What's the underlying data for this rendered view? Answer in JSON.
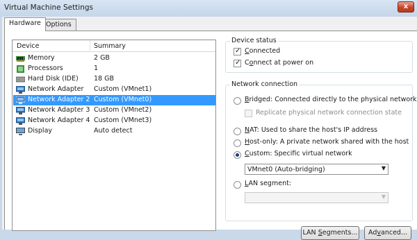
{
  "window": {
    "title": "Virtual Machine Settings",
    "close_label": "x"
  },
  "tabs": [
    {
      "label": "Hardware"
    },
    {
      "label": "Options"
    }
  ],
  "device_list": {
    "headers": {
      "device": "Device",
      "summary": "Summary"
    },
    "rows": [
      {
        "device": "Memory",
        "summary": "2 GB",
        "icon": "memory-icon"
      },
      {
        "device": "Processors",
        "summary": "1",
        "icon": "processor-icon"
      },
      {
        "device": "Hard Disk (IDE)",
        "summary": "18 GB",
        "icon": "hard-disk-icon"
      },
      {
        "device": "Network Adapter",
        "summary": "Custom (VMnet1)",
        "icon": "network-adapter-icon"
      },
      {
        "device": "Network Adapter 2",
        "summary": "Custom (VMnet0)",
        "icon": "network-adapter-icon",
        "selected": true
      },
      {
        "device": "Network Adapter 3",
        "summary": "Custom (VMnet2)",
        "icon": "network-adapter-icon"
      },
      {
        "device": "Network Adapter 4",
        "summary": "Custom (VMnet3)",
        "icon": "network-adapter-icon"
      },
      {
        "device": "Display",
        "summary": "Auto detect",
        "icon": "display-icon"
      }
    ]
  },
  "device_status": {
    "title": "Device status",
    "connected": {
      "pre": "",
      "key": "C",
      "post": "onnected",
      "checked": true
    },
    "connect_at_power_on": {
      "pre": "C",
      "key": "o",
      "post": "nnect at power on",
      "checked": true
    }
  },
  "network_connection": {
    "title": "Network connection",
    "bridged": {
      "key": "B",
      "post": "ridged: Connected directly to the physical network",
      "selected": false
    },
    "replicate": {
      "label": "Replicate physical network connection state",
      "checked": false,
      "disabled": true
    },
    "nat": {
      "key": "N",
      "post": "AT: Used to share the host's IP address",
      "selected": false
    },
    "host_only": {
      "key": "H",
      "post": "ost-only: A private network shared with the host",
      "selected": false
    },
    "custom": {
      "key": "C",
      "post": "ustom: Specific virtual network",
      "selected": true
    },
    "custom_select_value": "VMnet0 (Auto-bridging)",
    "lan_segment": {
      "key": "L",
      "post": "AN segment:",
      "selected": false
    },
    "lan_select_value": ""
  },
  "buttons": {
    "lan_segments": {
      "pre": "LAN ",
      "key": "S",
      "post": "egments..."
    },
    "advanced": {
      "pre": "Ad",
      "key": "v",
      "post": "anced..."
    }
  },
  "colors": {
    "selection": "#3399ff",
    "title_bar": "#c9d9ea",
    "close_button": "#c7462b"
  }
}
